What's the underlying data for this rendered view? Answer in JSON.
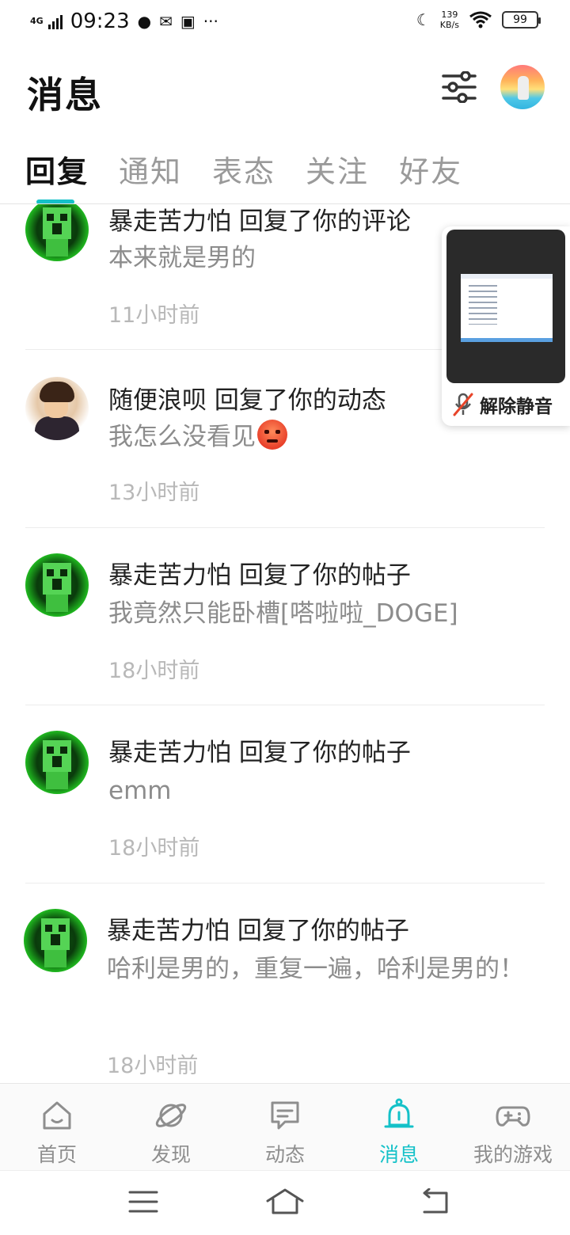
{
  "status_bar": {
    "network": "4G",
    "time": "09:23",
    "speed_value": "139",
    "speed_unit": "KB/s",
    "battery": "99"
  },
  "header": {
    "title": "消息"
  },
  "tabs": [
    {
      "label": "回复",
      "active": true
    },
    {
      "label": "通知",
      "active": false
    },
    {
      "label": "表态",
      "active": false
    },
    {
      "label": "关注",
      "active": false
    },
    {
      "label": "好友",
      "active": false
    }
  ],
  "messages": [
    {
      "avatar": "creeper-avatar",
      "title": "暴走苦力怕 回复了你的评论",
      "content": "本来就是男的",
      "time": "11小时前"
    },
    {
      "avatar": "harry-avatar",
      "title": "随便浪呗 回复了你的动态",
      "content": "我怎么没看见",
      "emoji": "angry-emoji",
      "time": "13小时前"
    },
    {
      "avatar": "creeper-avatar",
      "title": "暴走苦力怕 回复了你的帖子",
      "content": "我竟然只能卧槽[嗒啦啦_DOGE]",
      "time": "18小时前"
    },
    {
      "avatar": "creeper-avatar",
      "title": "暴走苦力怕 回复了你的帖子",
      "content": "emm",
      "time": "18小时前"
    },
    {
      "avatar": "creeper-avatar",
      "title": "暴走苦力怕 回复了你的帖子",
      "content": "哈利是男的，重复一遍，哈利是男的！",
      "time": "18小时前"
    }
  ],
  "pip": {
    "unmute_label": "解除静音"
  },
  "bottom_nav": [
    {
      "label": "首页",
      "icon": "home-icon",
      "active": false
    },
    {
      "label": "发现",
      "icon": "planet-icon",
      "active": false
    },
    {
      "label": "动态",
      "icon": "chat-icon",
      "active": false
    },
    {
      "label": "消息",
      "icon": "bell-icon",
      "active": true
    },
    {
      "label": "我的游戏",
      "icon": "gamepad-icon",
      "active": false
    }
  ],
  "colors": {
    "accent": "#14c1c8",
    "text_primary": "#222222",
    "text_secondary": "#8c8c8c",
    "text_time": "#b8b8b8"
  }
}
